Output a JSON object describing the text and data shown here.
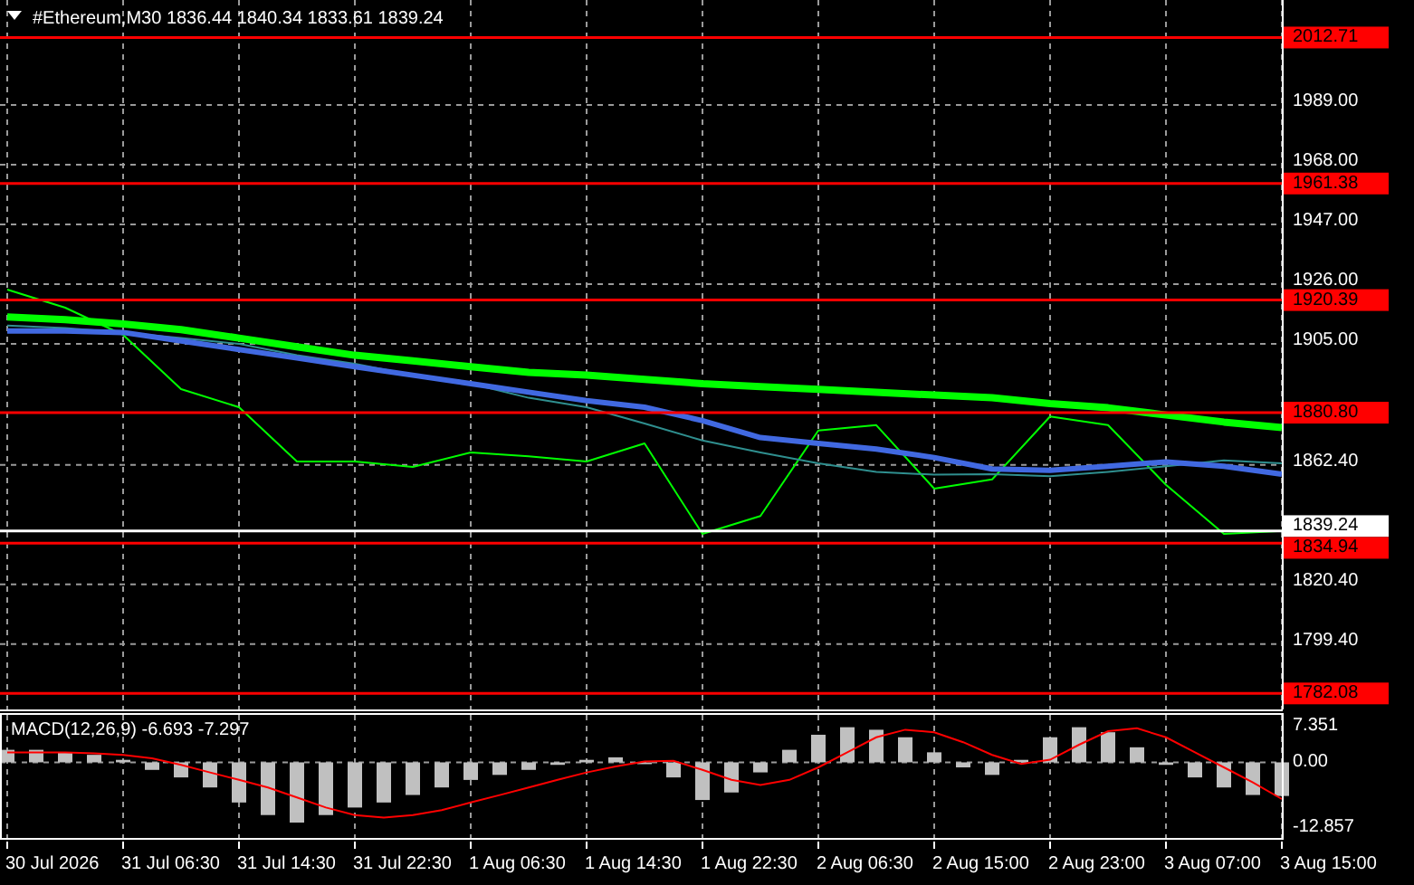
{
  "title_bar": {
    "symbol": "#Ethereum,M30",
    "ohlc": [
      "1836.44",
      "1840.34",
      "1833.61",
      "1839.24"
    ]
  },
  "price_chart": {
    "chart_data": {
      "type": "line",
      "categories": [
        null,
        null,
        null,
        null,
        null,
        null,
        null,
        null,
        null,
        null,
        null,
        null,
        null,
        null,
        null,
        null,
        null,
        null,
        null,
        null,
        null,
        null,
        null
      ],
      "ylim": [
        1776.45,
        2025.9
      ],
      "grid": true,
      "yticks": [
        {
          "value": 1989,
          "label": "1989.00"
        },
        {
          "value": 1968,
          "label": "1968.00"
        },
        {
          "value": 1947,
          "label": "1947.00"
        },
        {
          "value": 1926,
          "label": "1926.00"
        },
        {
          "value": 1905,
          "label": "1905.00"
        },
        {
          "value": 1862.4,
          "label": "1862.40"
        },
        {
          "value": 1820.4,
          "label": "1820.40"
        },
        {
          "value": 1799.4,
          "label": "1799.40"
        }
      ],
      "series": [
        {
          "color": "#00ff00",
          "values": [
            1924.1,
            1917.7,
            1908.2,
            1889.1,
            1882.7,
            1863.6,
            1863.6,
            1861.7,
            1866.8,
            1865.5,
            1863.6,
            1870.0,
            1838.2,
            1844.5,
            1874.5,
            1876.4,
            1854.1,
            1857.3,
            1879.5,
            1876.4,
            1855.4,
            1838.2,
            1839.2
          ]
        },
        {
          "color": "#2f8f8f",
          "values": [
            1911.4,
            1910.5,
            1909,
            1907,
            1905,
            1901,
            1898,
            1894,
            1891,
            1886,
            1882.7,
            1877,
            1871,
            1866.8,
            1863,
            1860,
            1859,
            1859.2,
            1858.5,
            1860,
            1862,
            1864,
            1863
          ]
        },
        {
          "color": "#4169e1",
          "values": [
            1909.5,
            1909.5,
            1909,
            1906,
            1903,
            1900,
            1897,
            1894,
            1891,
            1888,
            1885,
            1882.7,
            1878,
            1872,
            1870,
            1868,
            1865,
            1861,
            1860.5,
            1862,
            1863.5,
            1862,
            1859.2
          ]
        },
        {
          "color": "#00ff00",
          "values": [
            1914.5,
            1913.5,
            1912,
            1910,
            1907,
            1904,
            1901,
            1899,
            1897,
            1895,
            1894,
            1892.5,
            1891,
            1890,
            1889,
            1888,
            1887,
            1886,
            1884,
            1882.5,
            1880,
            1877.5,
            1875.6
          ]
        }
      ],
      "ref_lines": [
        {
          "axis": "y",
          "value": 2012.71,
          "label": "2012.71",
          "color": "#ff0000"
        },
        {
          "axis": "y",
          "value": 1961.38,
          "label": "1961.38",
          "color": "#ff0000"
        },
        {
          "axis": "y",
          "value": 1920.39,
          "label": "1920.39",
          "color": "#ff0000"
        },
        {
          "axis": "y",
          "value": 1880.8,
          "label": "1880.80",
          "color": "#ff0000"
        },
        {
          "axis": "y",
          "value": 1839.24,
          "label": "1839.24",
          "color": "#ffffff"
        },
        {
          "axis": "y",
          "value": 1834.94,
          "label": "1834.94",
          "color": "#ff0000"
        },
        {
          "axis": "y",
          "value": 1782.08,
          "label": "1782.08",
          "color": "#ff0000"
        }
      ]
    }
  },
  "macd": {
    "label": "MACD(12,26,9) -6.693 -7.297",
    "chart_data": {
      "type": "bar",
      "grid": true,
      "categories": [
        null,
        null,
        null,
        null,
        null,
        null,
        null,
        null,
        null,
        null,
        null,
        null,
        null,
        null,
        null,
        null,
        null,
        null,
        null,
        null,
        null,
        null,
        null,
        null,
        null,
        null,
        null,
        null,
        null,
        null,
        null,
        null,
        null,
        null,
        null,
        null,
        null,
        null,
        null,
        null,
        null,
        null,
        null,
        null,
        null
      ],
      "ylim": [
        -14.7,
        9.1
      ],
      "yticks": [
        {
          "value": 7.351,
          "label": "7.351"
        },
        {
          "value": 0,
          "label": "0.00"
        },
        {
          "value": -12.857,
          "label": "-12.857"
        }
      ],
      "series": [
        {
          "type": "bar",
          "color": "#c0c0c0",
          "values": [
            2.5,
            2.5,
            2,
            1.5,
            0.5,
            -1.5,
            -3,
            -5,
            -8,
            -10.5,
            -12,
            -10.5,
            -9,
            -8,
            -6.5,
            -5,
            -3.5,
            -2.5,
            -1.5,
            -0.5,
            0.5,
            1,
            0,
            -3,
            -7.5,
            -6,
            -2,
            2.5,
            5.5,
            7,
            6.5,
            5,
            2,
            -1,
            -2.5,
            0.5,
            5,
            7,
            6,
            3,
            -0.5,
            -3,
            -5,
            -6.5,
            -6.7
          ]
        },
        {
          "type": "line",
          "color": "#ff0000",
          "values": [
            2,
            2,
            2,
            1.8,
            1.5,
            0.8,
            -0.5,
            -2,
            -3.5,
            -5,
            -7,
            -9,
            -10.5,
            -11,
            -10.5,
            -9.5,
            -8,
            -6.5,
            -5,
            -3.5,
            -2,
            -0.8,
            0.2,
            0.3,
            -1.5,
            -3.5,
            -4.5,
            -3.5,
            -1,
            2,
            5,
            6.5,
            6,
            4,
            1.5,
            -0.3,
            0.5,
            3.5,
            6.2,
            6.8,
            5,
            2,
            -1,
            -4,
            -7.3
          ]
        }
      ]
    }
  },
  "time_axis": [
    "30 Jul 2026",
    "31 Jul 06:30",
    "31 Jul 14:30",
    "31 Jul 22:30",
    "1 Aug 06:30",
    "1 Aug 14:30",
    "1 Aug 22:30",
    "2 Aug 06:30",
    "2 Aug 15:00",
    "2 Aug 23:00",
    "3 Aug 07:00",
    "3 Aug 15:00"
  ]
}
